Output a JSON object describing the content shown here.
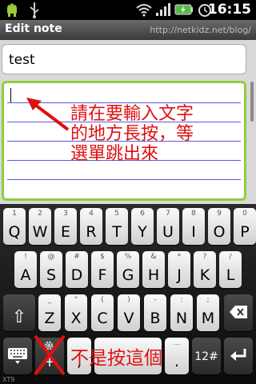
{
  "status_bar": {
    "icons": [
      "android-icon",
      "usb-icon",
      "wifi-icon",
      "signal-icon",
      "battery-icon",
      "alarm-icon"
    ],
    "time": "16:15"
  },
  "app_bar": {
    "title": "Edit note",
    "watermark": "http://netkidz.net/blog/"
  },
  "editor": {
    "title_value": "test",
    "body_value": ""
  },
  "annotations": {
    "top_lines": [
      "請在要輸入文字",
      "的地方長按，等",
      "選單跳出來"
    ],
    "bottom": "不是按這個"
  },
  "keyboard": {
    "row1": [
      [
        "1",
        "Q"
      ],
      [
        "2",
        "W"
      ],
      [
        "3",
        "E"
      ],
      [
        "4",
        "R"
      ],
      [
        "5",
        "T"
      ],
      [
        "6",
        "Y"
      ],
      [
        "7",
        "U"
      ],
      [
        "8",
        "I"
      ],
      [
        "9",
        "O"
      ],
      [
        "0",
        "P"
      ]
    ],
    "row2": [
      [
        "!",
        "A"
      ],
      [
        "@",
        "S"
      ],
      [
        "#",
        "D"
      ],
      [
        "$",
        "F"
      ],
      [
        "%",
        "G"
      ],
      [
        "&",
        "H"
      ],
      [
        "*",
        "J"
      ],
      [
        "?",
        "K"
      ],
      [
        "/",
        "L"
      ]
    ],
    "row3": [
      [
        "_",
        "Z"
      ],
      [
        "\"",
        "X"
      ],
      [
        "(",
        "C"
      ],
      [
        ")",
        "V"
      ],
      [
        "-",
        "B"
      ],
      [
        ":",
        "N"
      ],
      [
        ";",
        "M"
      ]
    ],
    "keys": {
      "shift": "⇧",
      "backspace": "⌫",
      "enter": "↵",
      "symbols": "12#",
      "comma": ",",
      "period": ".",
      "space": " ",
      "period_sub": "…"
    },
    "footer_tag": "XT9"
  }
}
